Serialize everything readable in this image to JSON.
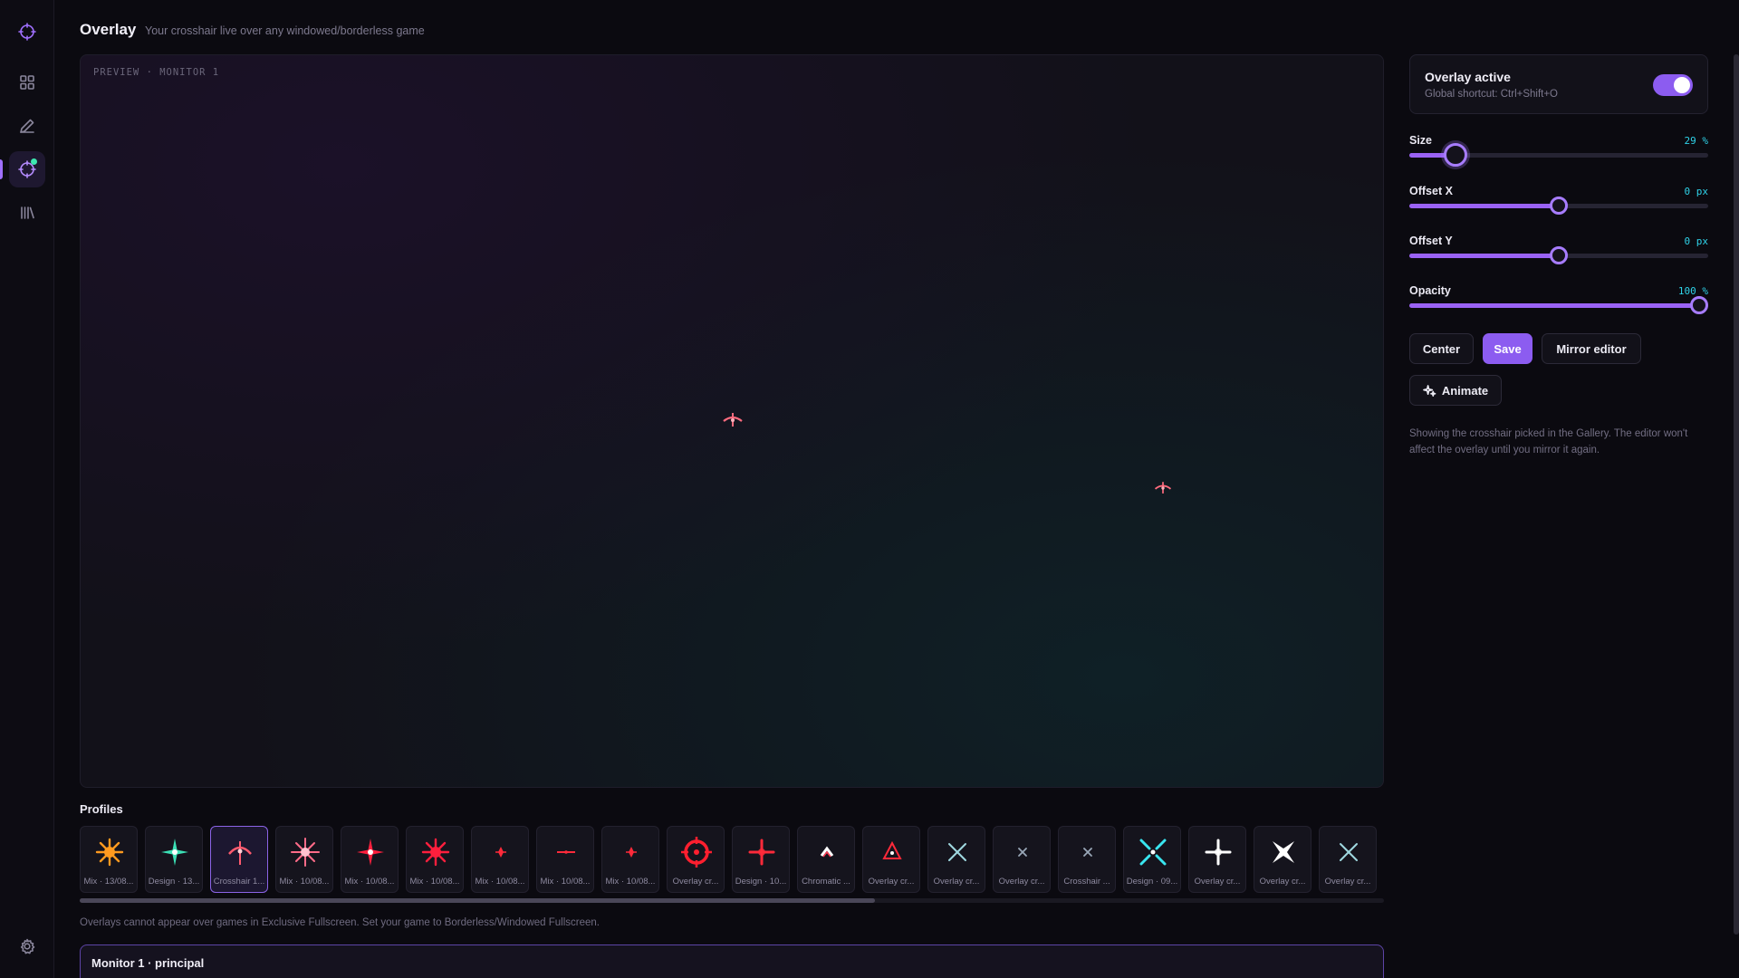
{
  "app": {
    "page_title": "Overlay",
    "page_subtitle": "Your crosshair live over any windowed/borderless game",
    "accent_color": "#8c5cf0",
    "value_color": "#2fd2e8"
  },
  "sidebar": {
    "items": [
      {
        "icon": "crosshair-logo-icon"
      },
      {
        "icon": "grid-icon"
      },
      {
        "icon": "pencil-icon"
      },
      {
        "icon": "overlay-crosshair-icon",
        "active": true,
        "badge_color": "#3ee6b0"
      },
      {
        "icon": "library-icon"
      }
    ],
    "settings_icon": "gear-icon"
  },
  "preview": {
    "label": "PREVIEW · MONITOR 1",
    "crosshair_color": "#ff5a6e"
  },
  "profiles": {
    "title": "Profiles",
    "items": [
      {
        "label": "Mix · 13/08...",
        "color": "#ff9a1f",
        "shape": "burst"
      },
      {
        "label": "Design · 13...",
        "color": "#3be0b5",
        "shape": "star4"
      },
      {
        "label": "Crosshair 1...",
        "color": "#ff5a6e",
        "shape": "arc",
        "selected": true
      },
      {
        "label": "Mix · 10/08...",
        "color": "#ff6b88",
        "shape": "spark"
      },
      {
        "label": "Mix · 10/08...",
        "color": "#ff1f3d",
        "shape": "star4"
      },
      {
        "label": "Mix · 10/08...",
        "color": "#ff1f3d",
        "shape": "burst"
      },
      {
        "label": "Mix · 10/08...",
        "color": "#ff2a3a",
        "shape": "dotcross"
      },
      {
        "label": "Mix · 10/08...",
        "color": "#ff2a3a",
        "shape": "line"
      },
      {
        "label": "Mix · 10/08...",
        "color": "#ff2a3a",
        "shape": "dotcross"
      },
      {
        "label": "Overlay cr...",
        "color": "#ff1f2f",
        "shape": "circle"
      },
      {
        "label": "Design · 10...",
        "color": "#ff2a3a",
        "shape": "plus"
      },
      {
        "label": "Chromatic ...",
        "color": "#ffffff",
        "shape": "chevron"
      },
      {
        "label": "Overlay cr...",
        "color": "#ff2a3a",
        "shape": "tri"
      },
      {
        "label": "Overlay cr...",
        "color": "#9fd8e0",
        "shape": "x"
      },
      {
        "label": "Overlay cr...",
        "color": "#9aa8b8",
        "shape": "xsmall"
      },
      {
        "label": "Crosshair ...",
        "color": "#9aa8b8",
        "shape": "xsmall"
      },
      {
        "label": "Design · 09...",
        "color": "#39e6f0",
        "shape": "xbig"
      },
      {
        "label": "Overlay cr...",
        "color": "#ffffff",
        "shape": "plus"
      },
      {
        "label": "Overlay cr...",
        "color": "#ffffff",
        "shape": "xbold"
      },
      {
        "label": "Overlay cr...",
        "color": "#9fd8e0",
        "shape": "x"
      }
    ],
    "scroll_fraction": 0.61
  },
  "warning": "Overlays cannot appear over games in Exclusive Fullscreen. Set your game to Borderless/Windowed Fullscreen.",
  "monitor": {
    "title": "Monitor 1 · principal"
  },
  "panel": {
    "overlay_title": "Overlay active",
    "overlay_shortcut": "Global shortcut: Ctrl+Shift+O",
    "overlay_enabled": true,
    "sliders": [
      {
        "key": "size",
        "label": "Size",
        "value_text": "29 %",
        "fraction": 0.155
      },
      {
        "key": "offset_x",
        "label": "Offset X",
        "value_text": "0 px",
        "fraction": 0.5
      },
      {
        "key": "offset_y",
        "label": "Offset Y",
        "value_text": "0 px",
        "fraction": 0.5
      },
      {
        "key": "opacity",
        "label": "Opacity",
        "value_text": "100 %",
        "fraction": 0.97
      }
    ],
    "buttons": {
      "center": "Center",
      "save": "Save",
      "mirror": "Mirror editor",
      "animate": "Animate"
    },
    "note": "Showing the crosshair picked in the Gallery. The editor won't affect the overlay until you mirror it again."
  }
}
